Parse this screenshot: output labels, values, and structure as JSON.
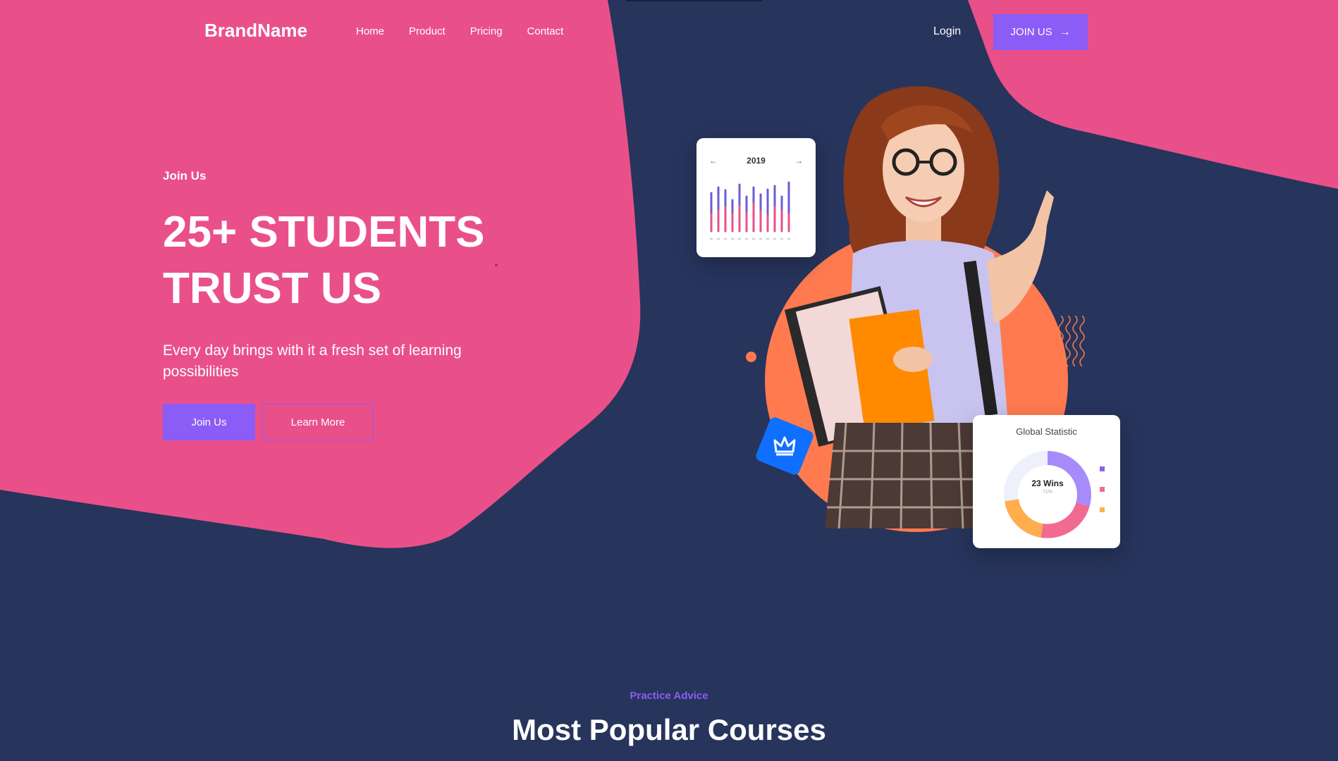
{
  "nav": {
    "brand": "BrandName",
    "links": [
      "Home",
      "Product",
      "Pricing",
      "Contact"
    ],
    "login_label": "Login",
    "join_label": "JOIN US",
    "join_icon": "arrow-right-icon"
  },
  "hero": {
    "eyebrow": "Join Us",
    "headline_line1": "25+ STUDENTS",
    "headline_line2": "TRUST US",
    "subtitle": "Every day brings with it a fresh set of learning possibilities",
    "primary_button": "Join Us",
    "secondary_button": "Learn More"
  },
  "chart_card": {
    "year": "2019",
    "prev_icon": "arrow-left-icon",
    "next_icon": "arrow-right-icon"
  },
  "stat_card": {
    "title": "Global Statistic",
    "center_label": "23 Wins",
    "center_sub": "71%"
  },
  "section": {
    "eyebrow": "Practice Advice",
    "title": "Most Popular Courses"
  },
  "colors": {
    "background": "#27345c",
    "pink": "#e9508a",
    "purple": "#8b5cf6",
    "orange": "#ff7a4f",
    "badge_blue": "#0f6fff"
  }
}
